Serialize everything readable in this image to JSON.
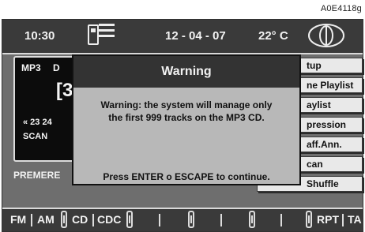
{
  "ref": "A0E4118g",
  "topbar": {
    "time": "10:30",
    "date": "12 - 04 - 07",
    "temperature": "22° C"
  },
  "panel": {
    "format": "MP3",
    "disc_label_partial": "D",
    "track_partial": "[3",
    "position_partial": "« 23 24",
    "scan": "SCAN"
  },
  "premere": "PREMERE",
  "menu_items": [
    "tup",
    "ne Playlist",
    "aylist",
    "pression",
    "aff.Ann.",
    "can",
    "Shuffle"
  ],
  "dialog": {
    "title": "Warning",
    "message_line1": "Warning: the system will manage only",
    "message_line2": "the first 999 tracks on the MP3 CD.",
    "footer": "Press ENTER o ESCAPE to continue."
  },
  "bottombar": {
    "fm": "FM",
    "am": "AM",
    "cd": "CD",
    "cdc": "CDC",
    "rpt": "RPT",
    "ta": "TA"
  }
}
